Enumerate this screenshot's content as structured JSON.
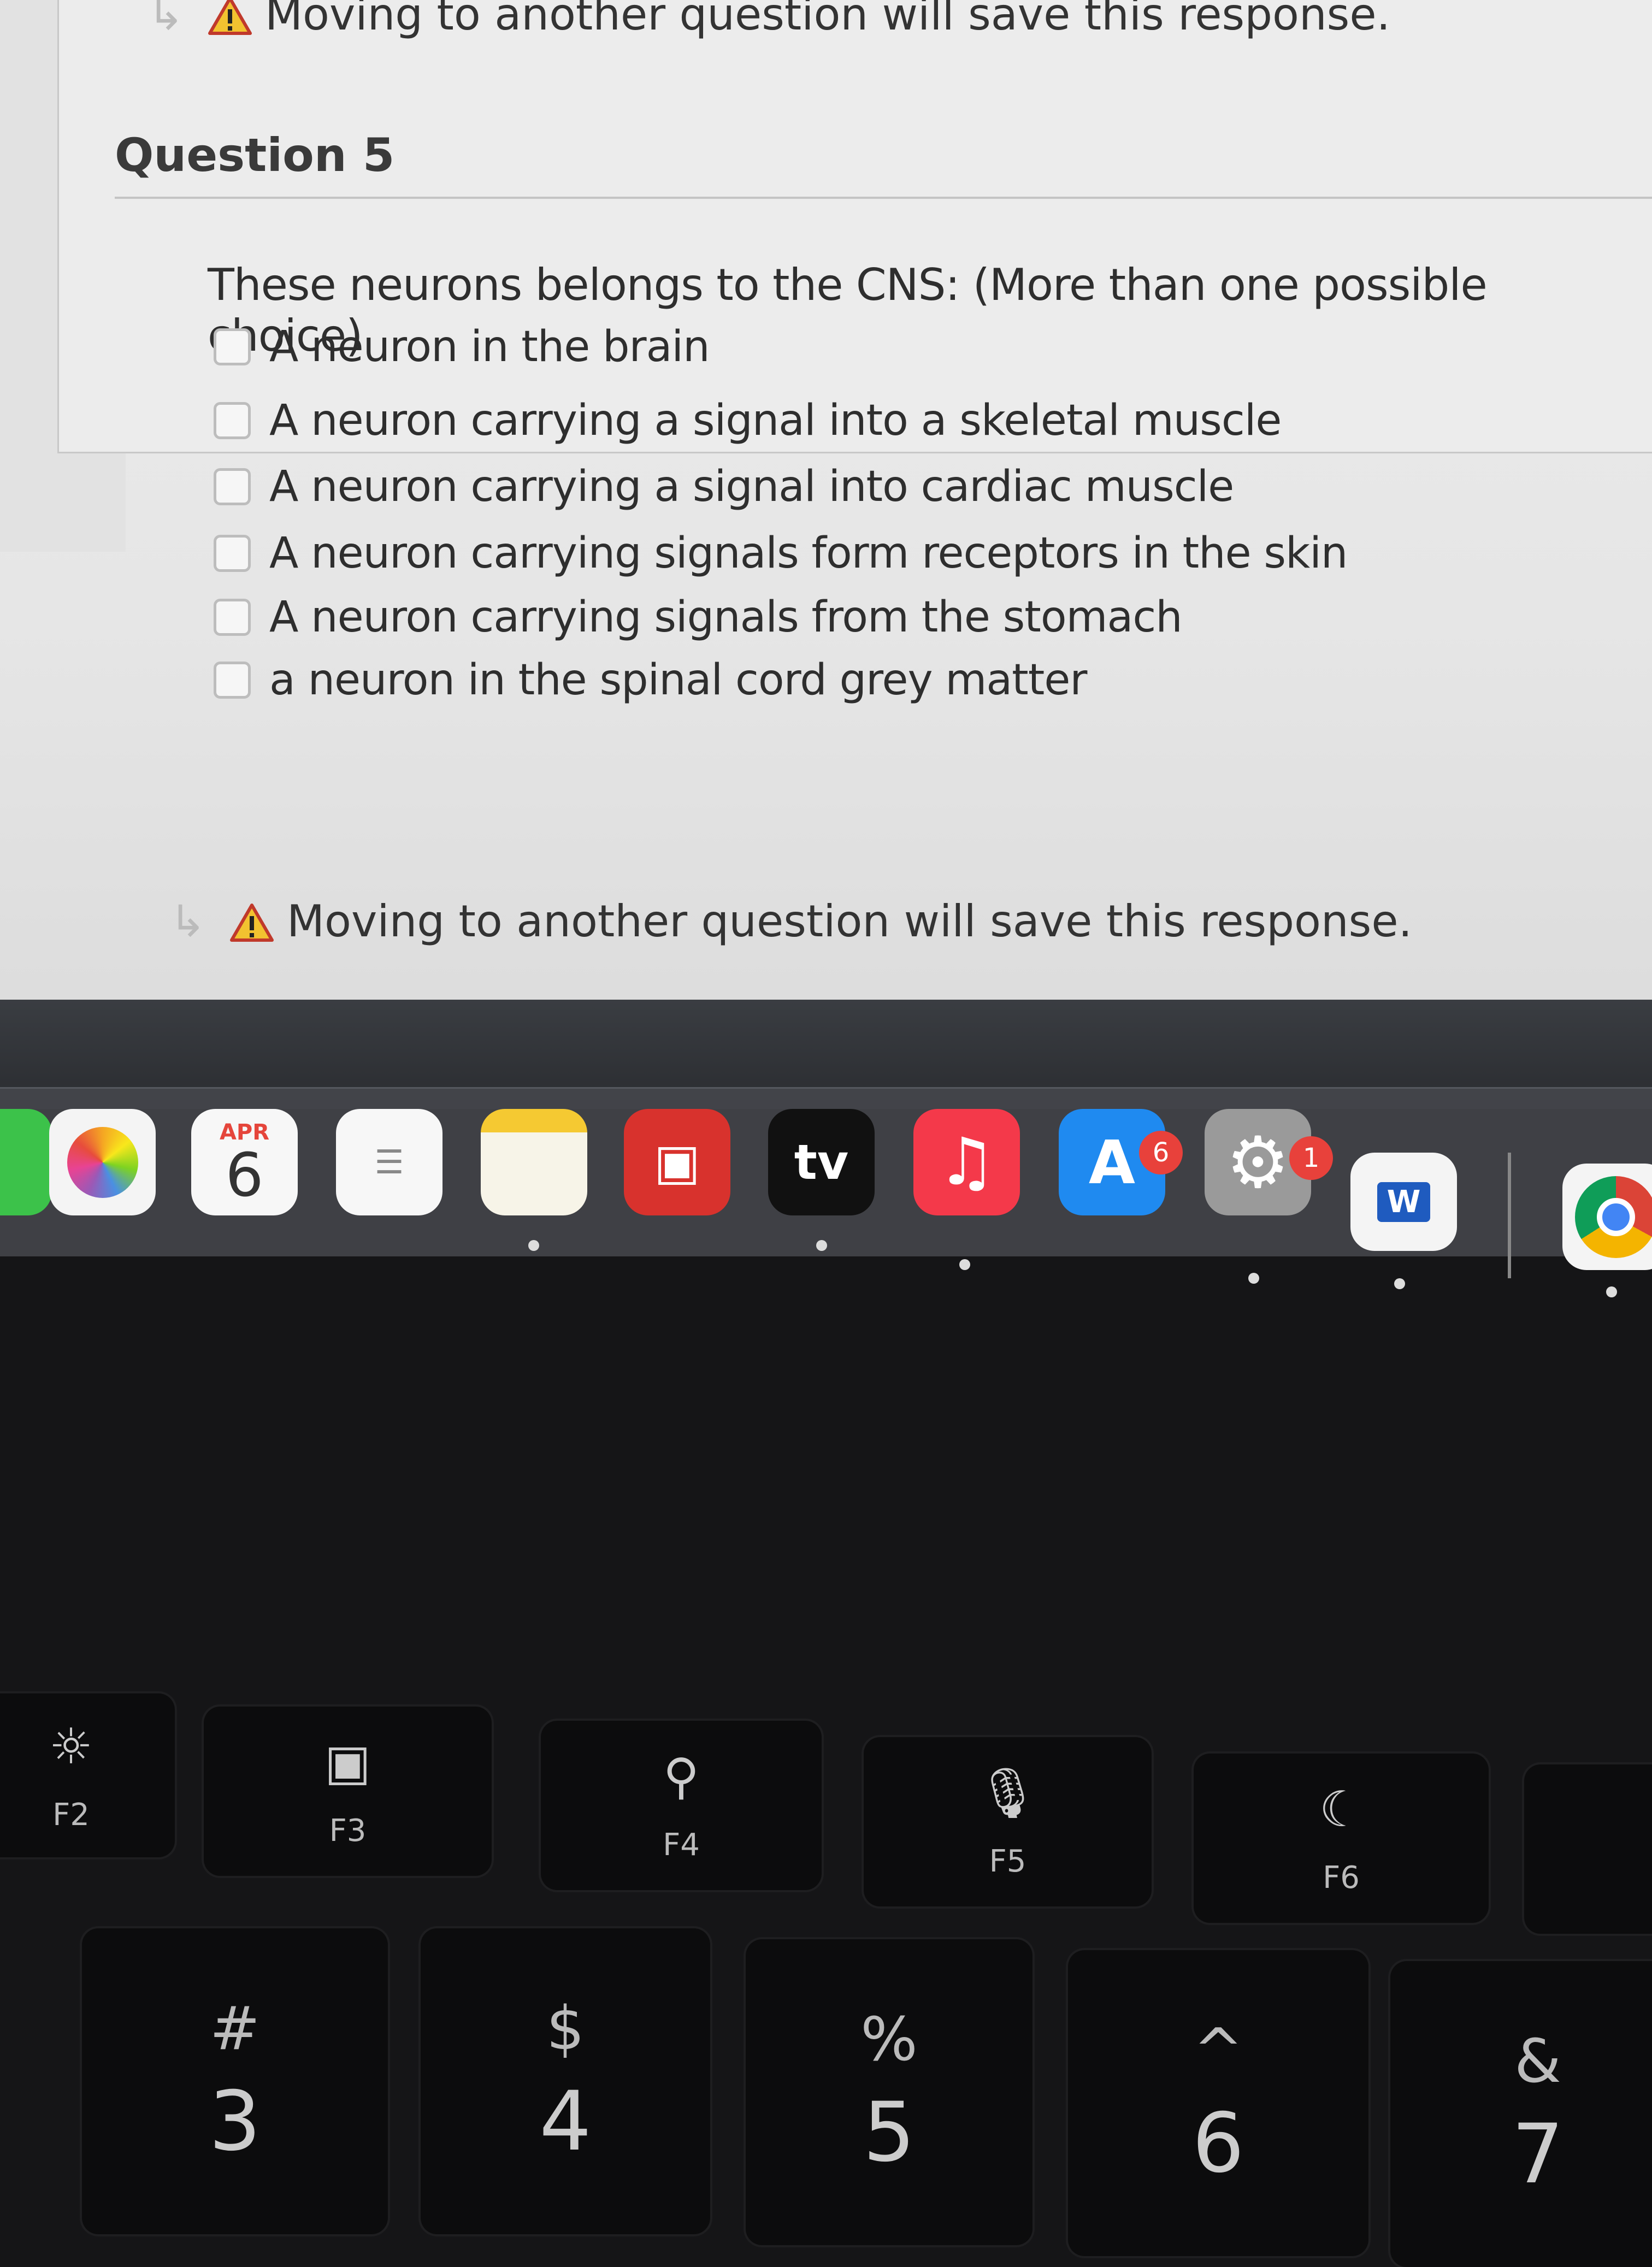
{
  "warning_text": "Moving to another question will save this response.",
  "question": {
    "title": "Question 5",
    "text": "These neurons belongs to the CNS: (More than one possible choice)",
    "options": [
      {
        "label": "A neuron in the brain",
        "checked": false
      },
      {
        "label": "A neuron carrying a signal into a skeletal muscle",
        "checked": false
      },
      {
        "label": "A neuron carrying a signal into cardiac muscle",
        "checked": false
      },
      {
        "label": "A neuron carrying signals form receptors in the skin",
        "checked": false
      },
      {
        "label": "A neuron carrying signals from the stomach",
        "checked": false
      },
      {
        "label": "a neuron in the spinal cord grey matter",
        "checked": false
      }
    ]
  },
  "dock": {
    "calendar_month": "APR",
    "calendar_day": "6",
    "tv_label": "tv",
    "appstore_badge": "6",
    "settings_badge": "1",
    "word_letter": "W"
  },
  "keyboard": {
    "fkeys": [
      {
        "label": "F2",
        "icon": "brightness-icon"
      },
      {
        "label": "F3",
        "icon": "mission-control-icon"
      },
      {
        "label": "F4",
        "icon": "search-icon"
      },
      {
        "label": "F5",
        "icon": "microphone-icon"
      },
      {
        "label": "F6",
        "icon": "moon-icon"
      }
    ],
    "numkeys": [
      {
        "sym": "#",
        "num": "3"
      },
      {
        "sym": "$",
        "num": "4"
      },
      {
        "sym": "%",
        "num": "5"
      },
      {
        "sym": "^",
        "num": "6"
      },
      {
        "sym": "&",
        "num": "7"
      }
    ]
  }
}
